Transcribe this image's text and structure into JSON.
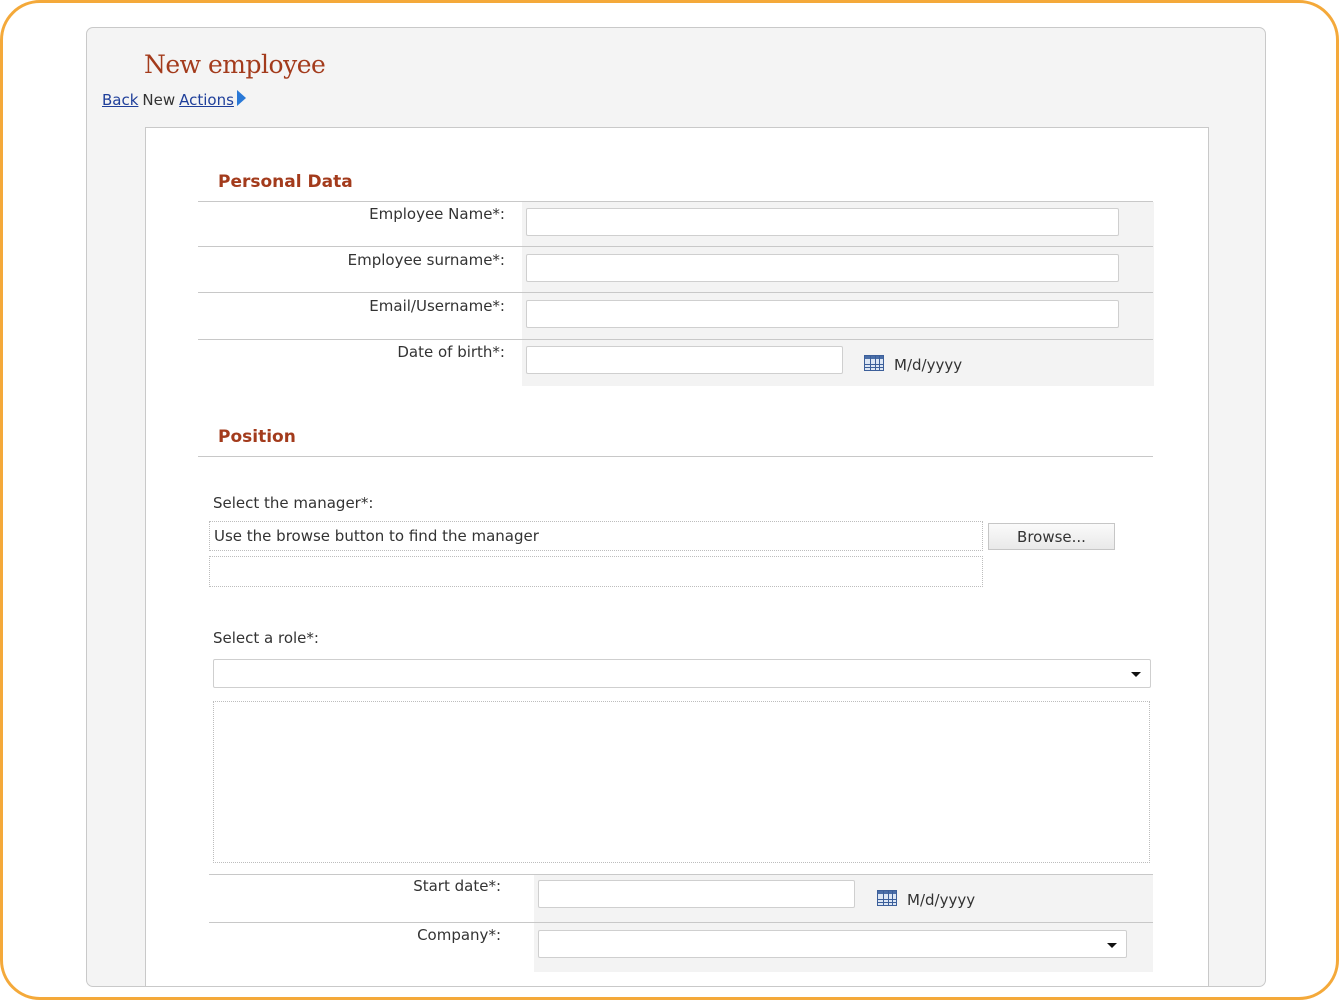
{
  "page": {
    "title": "New employee",
    "breadcrumb": {
      "back": "Back",
      "current": "New",
      "actions": "Actions"
    }
  },
  "personal_data": {
    "heading": "Personal Data",
    "employee_name_label": "Employee Name*:",
    "employee_name_value": "",
    "employee_surname_label": "Employee surname*:",
    "employee_surname_value": "",
    "email_label": "Email/Username*:",
    "email_value": "",
    "dob_label": "Date of birth*:",
    "dob_value": "",
    "dob_format": "M/d/yyyy",
    "calendar_icon": "calendar-icon"
  },
  "position": {
    "heading": "Position",
    "manager_label": "Select the manager*:",
    "manager_hint": "Use the browse button to find the manager",
    "browse_label": "Browse...",
    "role_label": "Select a role*:",
    "role_selected": "",
    "start_date_label": "Start date*:",
    "start_date_value": "",
    "start_date_format": "M/d/yyyy",
    "company_label": "Company*:",
    "company_selected": ""
  },
  "colors": {
    "accent_frame": "#f4a93a",
    "heading": "#a33b1c",
    "link": "#1f3f9a"
  }
}
